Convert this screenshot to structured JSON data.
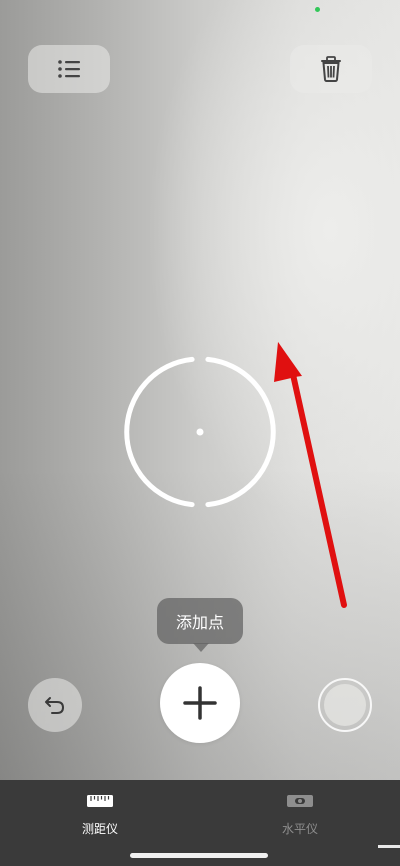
{
  "tooltip": {
    "label": "添加点"
  },
  "tabs": [
    {
      "label": "测距仪",
      "icon": "ruler-icon",
      "selected": true
    },
    {
      "label": "水平仪",
      "icon": "level-icon",
      "selected": false
    }
  ],
  "toolbar": {
    "list_icon": "list-icon",
    "trash_icon": "trash-icon",
    "undo_icon": "undo-icon",
    "add_icon": "plus-icon",
    "capture_icon": "shutter-icon"
  },
  "colors": {
    "annotation_arrow": "#e01010",
    "tab_bar": "#3a3a3a",
    "status_dot": "#33c759"
  }
}
